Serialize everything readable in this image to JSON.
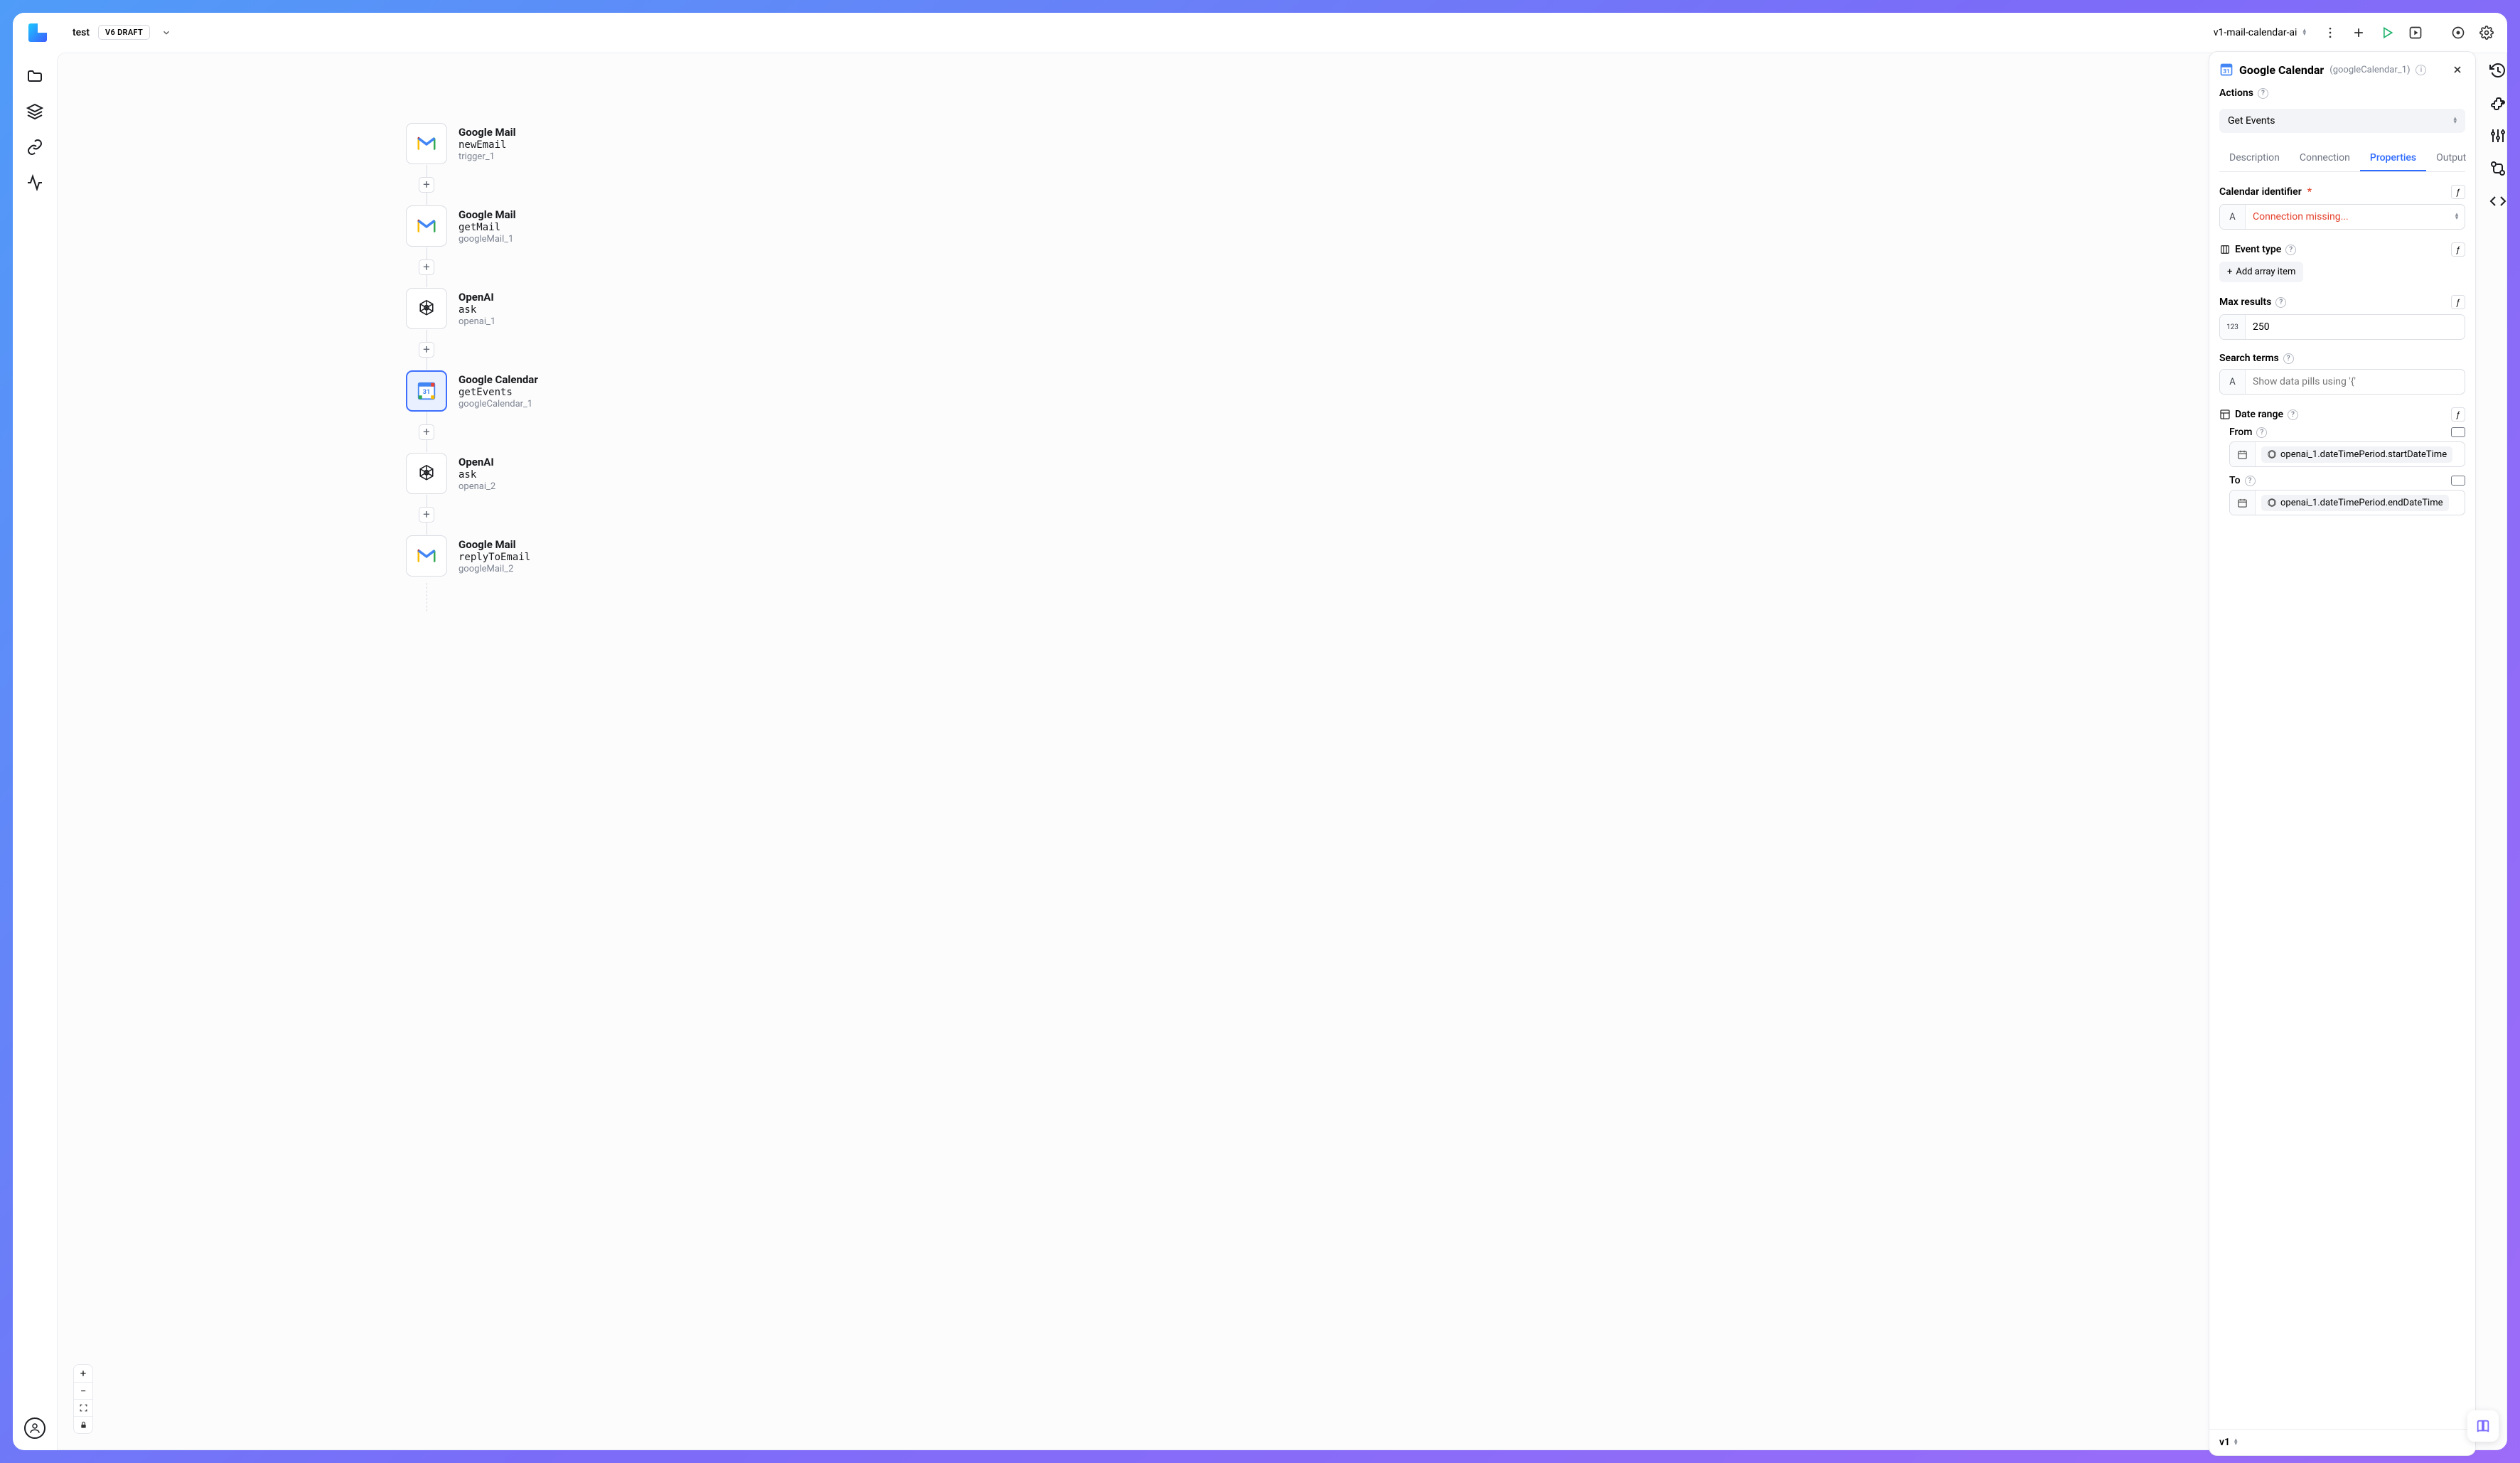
{
  "topbar": {
    "flow_name": "test",
    "draft_badge": "V6 DRAFT",
    "env_name": "v1-mail-calendar-ai"
  },
  "flow_nodes": [
    {
      "title": "Google Mail",
      "method": "newEmail",
      "id": "trigger_1",
      "icon": "gmail",
      "selected": false
    },
    {
      "title": "Google Mail",
      "method": "getMail",
      "id": "googleMail_1",
      "icon": "gmail",
      "selected": false
    },
    {
      "title": "OpenAI",
      "method": "ask",
      "id": "openai_1",
      "icon": "openai",
      "selected": false
    },
    {
      "title": "Google Calendar",
      "method": "getEvents",
      "id": "googleCalendar_1",
      "icon": "gcal",
      "selected": true
    },
    {
      "title": "OpenAI",
      "method": "ask",
      "id": "openai_2",
      "icon": "openai",
      "selected": false
    },
    {
      "title": "Google Mail",
      "method": "replyToEmail",
      "id": "googleMail_2",
      "icon": "gmail",
      "selected": false
    }
  ],
  "inspector": {
    "title": "Google Calendar",
    "paren_id": "(googleCalendar_1)",
    "actions_label": "Actions",
    "action_selected": "Get Events",
    "tabs": {
      "description": "Description",
      "connection": "Connection",
      "properties": "Properties",
      "output": "Output"
    },
    "props": {
      "calendar_id_label": "Calendar identifier",
      "calendar_id_value": "Connection missing...",
      "event_type_label": "Event type",
      "add_array_item": "Add array item",
      "max_results_label": "Max results",
      "max_results_value": "250",
      "search_terms_label": "Search terms",
      "search_terms_placeholder": "Show data pills using '{'",
      "date_range_label": "Date range",
      "from_label": "From",
      "from_pill": "openai_1.dateTimePeriod.startDateTime",
      "to_label": "To",
      "to_pill": "openai_1.dateTimePeriod.endDateTime"
    },
    "version": "v1"
  }
}
